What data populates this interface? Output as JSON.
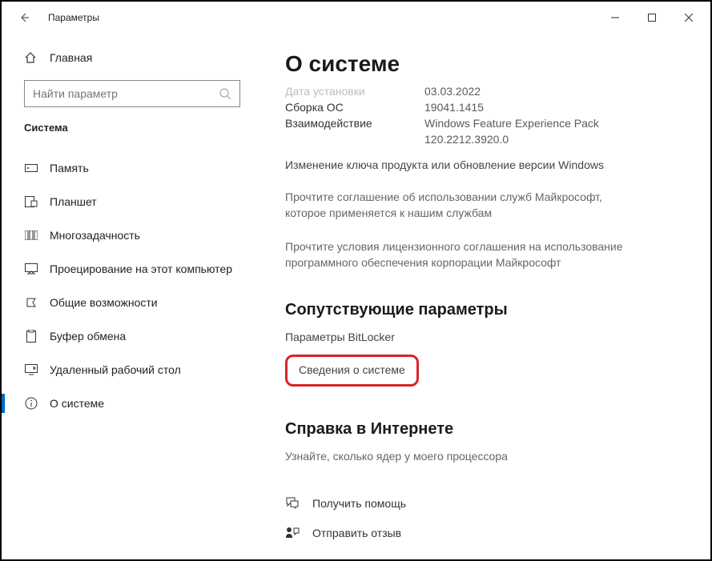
{
  "window": {
    "title": "Параметры"
  },
  "sidebar": {
    "home": "Главная",
    "search_placeholder": "Найти параметр",
    "section": "Система",
    "items": [
      {
        "label": "Память"
      },
      {
        "label": "Планшет"
      },
      {
        "label": "Многозадачность"
      },
      {
        "label": "Проецирование на этот компьютер"
      },
      {
        "label": "Общие возможности"
      },
      {
        "label": "Буфер обмена"
      },
      {
        "label": "Удаленный рабочий стол"
      },
      {
        "label": "О системе"
      }
    ]
  },
  "main": {
    "heading": "О системе",
    "row_cut": {
      "k": "Дата установки",
      "v": "03.03.2022"
    },
    "row_build": {
      "k": "Сборка ОС",
      "v": "19041.1415"
    },
    "row_exp": {
      "k": "Взаимодействие",
      "v": "Windows Feature Experience Pack 120.2212.3920.0"
    },
    "link_key": "Изменение ключа продукта или обновление версии Windows",
    "para1": "Прочтите соглашение об использовании служб Майкрософт, которое применяется к нашим службам",
    "para2": "Прочтите условия лицензионного соглашения на использование программного обеспечения корпорации Майкрософт",
    "related_heading": "Сопутствующие параметры",
    "related_bitlocker": "Параметры BitLocker",
    "related_sysinfo": "Сведения о системе",
    "help_heading": "Справка в Интернете",
    "help_cores": "Узнайте, сколько ядер у моего процессора",
    "get_help": "Получить помощь",
    "feedback": "Отправить отзыв"
  }
}
